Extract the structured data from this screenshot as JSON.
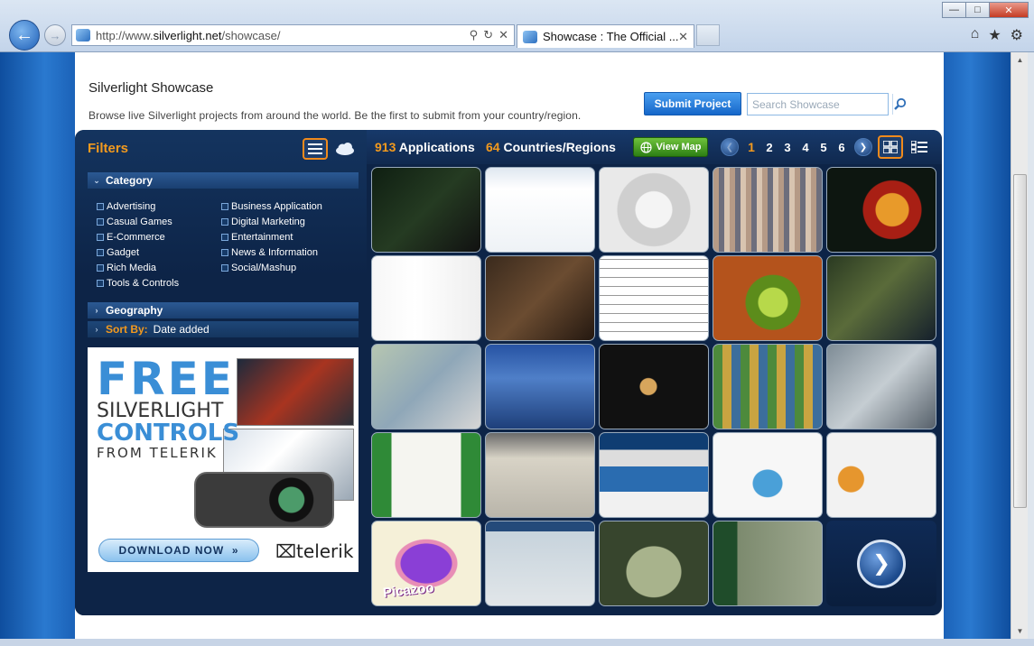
{
  "browser": {
    "url_prefix": "http://www.",
    "url_domain": "silverlight.net",
    "url_path": "/showcase/",
    "tab_title": "Showcase : The Official ...",
    "window_controls": [
      "minimize-icon",
      "maximize-icon",
      "close-icon"
    ],
    "toolbar_icons": [
      "home-icon",
      "star-icon",
      "gear-icon"
    ]
  },
  "header": {
    "title": "Silverlight Showcase",
    "description": "Browse live Silverlight projects from around the world. Be the first to submit from your country/region.",
    "submit_label": "Submit Project",
    "search_placeholder": "Search Showcase"
  },
  "filters": {
    "title": "Filters",
    "category_label": "Category",
    "categories": [
      "Advertising",
      "Business Application",
      "Casual Games",
      "Digital Marketing",
      "E-Commerce",
      "Entertainment",
      "Gadget",
      "News & Information",
      "Rich Media",
      "Social/Mashup",
      "Tools & Controls"
    ],
    "geography_label": "Geography",
    "sort_label": "Sort By:",
    "sort_value": "Date added"
  },
  "ad": {
    "line1": "FREE",
    "line2": "SILVERLIGHT",
    "line3": "CONTROLS",
    "line4": "FROM TELERIK",
    "download_label": "DOWNLOAD NOW",
    "brand": "telerik"
  },
  "results": {
    "app_count": "913",
    "app_label": "Applications",
    "country_count": "64",
    "country_label": "Countries/Regions",
    "view_map_label": "View Map",
    "pages": [
      "1",
      "2",
      "3",
      "4",
      "5",
      "6"
    ],
    "current_page": "1",
    "picazoo_label": "Picazoo"
  },
  "colors": {
    "accent_orange": "#f39a1e",
    "panel_navy": "#0d2447",
    "submit_blue": "#1e6fd0",
    "map_green": "#3f9a22"
  }
}
